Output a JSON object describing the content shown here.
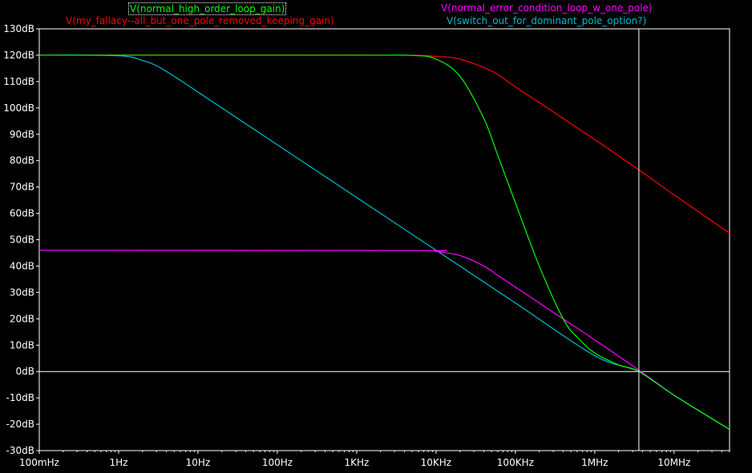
{
  "chart_data": {
    "type": "line",
    "xscale": "log",
    "xlim": [
      0.1,
      50000000
    ],
    "ylim": [
      -30,
      130
    ],
    "x_tick_labels": [
      "100mHz",
      "1Hz",
      "10Hz",
      "100Hz",
      "1KHz",
      "10KHz",
      "100KHz",
      "1MHz",
      "10MHz"
    ],
    "x_tick_values": [
      0.1,
      1,
      10,
      100,
      1000,
      10000,
      100000,
      1000000,
      10000000
    ],
    "y_tick_labels": [
      "130dB",
      "120dB",
      "110dB",
      "100dB",
      "90dB",
      "80dB",
      "70dB",
      "60dB",
      "50dB",
      "40dB",
      "30dB",
      "20dB",
      "10dB",
      "0dB",
      "-10dB",
      "-20dB",
      "-30dB"
    ],
    "y_tick_values": [
      130,
      120,
      110,
      100,
      90,
      80,
      70,
      60,
      50,
      40,
      30,
      20,
      10,
      0,
      -10,
      -20,
      -30
    ],
    "cursor_x": 3600000,
    "background": "#000000",
    "axis_color": "#ffffff",
    "grid": false,
    "series": [
      {
        "name": "V(normal_high_order_loop_gain)",
        "color": "#00ff00",
        "legend_position": "top-left",
        "legend_boxed": true,
        "points": [
          [
            0.1,
            120
          ],
          [
            1000,
            120
          ],
          [
            5000,
            119.9
          ],
          [
            10000,
            118.5
          ],
          [
            20000,
            112
          ],
          [
            40000,
            96
          ],
          [
            60000,
            82
          ],
          [
            100000,
            64
          ],
          [
            200000,
            40
          ],
          [
            400000,
            20
          ],
          [
            600000,
            13
          ],
          [
            1000000,
            7
          ],
          [
            2000000,
            2.5
          ],
          [
            3600000,
            0
          ],
          [
            10000000,
            -9
          ],
          [
            50000000,
            -22
          ]
        ]
      },
      {
        "name": "V(my_fallacy--all_but_one_pole_removed_keeping_gain)",
        "color": "#ff0000",
        "legend_position": "top-left",
        "legend_boxed": false,
        "points": [
          [
            0.1,
            120
          ],
          [
            2000,
            120
          ],
          [
            10000,
            119.5
          ],
          [
            20000,
            118.5
          ],
          [
            50000,
            114
          ],
          [
            100000,
            108
          ],
          [
            300000,
            98.5
          ],
          [
            1000000,
            88
          ],
          [
            3600000,
            76.5
          ],
          [
            10000000,
            67
          ],
          [
            50000000,
            52.5
          ]
        ]
      },
      {
        "name": "V(normal_error_condition_loop_w_one_pole)",
        "color": "#ff00ff",
        "legend_position": "top-right",
        "legend_boxed": false,
        "points": [
          [
            0.1,
            46
          ],
          [
            5000,
            45.9
          ],
          [
            10000,
            45.5
          ],
          [
            20000,
            44
          ],
          [
            40000,
            40
          ],
          [
            60000,
            36.5
          ],
          [
            100000,
            32
          ],
          [
            200000,
            26
          ],
          [
            500000,
            18
          ],
          [
            1000000,
            12
          ],
          [
            3600000,
            0.5
          ],
          [
            10000000,
            -9
          ],
          [
            50000000,
            -22
          ]
        ]
      },
      {
        "name": "V(switch_out_for_dominant_pole_option?)",
        "color": "#00bbcc",
        "legend_position": "top-right",
        "legend_boxed": false,
        "points": [
          [
            0.1,
            120
          ],
          [
            1,
            119.8
          ],
          [
            2,
            118
          ],
          [
            3,
            116
          ],
          [
            5,
            112
          ],
          [
            10,
            106
          ],
          [
            100,
            86
          ],
          [
            1000,
            66
          ],
          [
            10000,
            46
          ],
          [
            100000,
            26
          ],
          [
            1000000,
            6
          ],
          [
            3600000,
            0
          ],
          [
            10000000,
            -9
          ],
          [
            50000000,
            -22
          ]
        ]
      }
    ]
  }
}
